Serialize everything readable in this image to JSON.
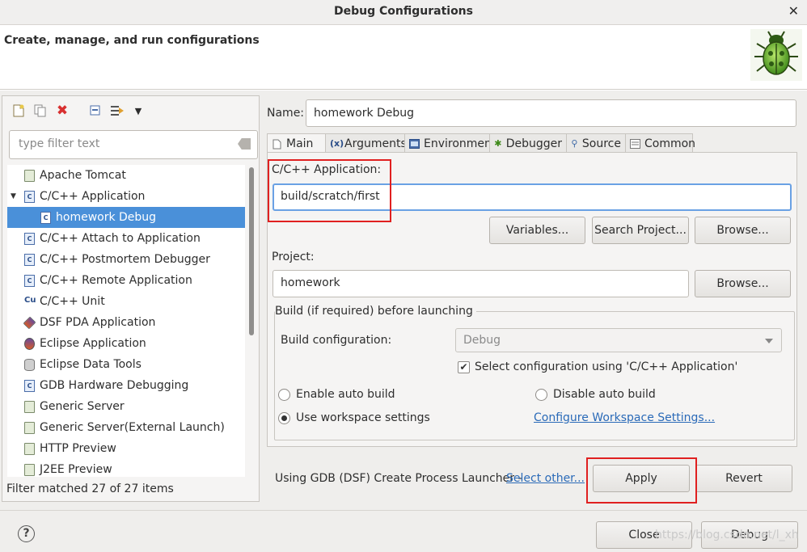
{
  "window": {
    "title": "Debug Configurations",
    "close_glyph": "✕"
  },
  "header": {
    "subtitle": "Create, manage, and run configurations"
  },
  "left": {
    "toolbar": [
      "new-configuration-icon",
      "duplicate-icon",
      "delete-icon",
      "collapse-all-icon",
      "filter-icon",
      "view-menu-icon"
    ],
    "filter_placeholder": "type filter text",
    "tree": [
      {
        "label": "Apache Tomcat"
      },
      {
        "label": "C/C++ Application"
      },
      {
        "label": "homework Debug"
      },
      {
        "label": "C/C++ Attach to Application"
      },
      {
        "label": "C/C++ Postmortem Debugger"
      },
      {
        "label": "C/C++ Remote Application"
      },
      {
        "label": "C/C++ Unit"
      },
      {
        "label": "DSF PDA Application"
      },
      {
        "label": "Eclipse Application"
      },
      {
        "label": "Eclipse Data Tools"
      },
      {
        "label": "GDB Hardware Debugging"
      },
      {
        "label": "Generic Server"
      },
      {
        "label": "Generic Server(External Launch)"
      },
      {
        "label": "HTTP Preview"
      },
      {
        "label": "J2EE Preview"
      }
    ],
    "status": "Filter matched 27 of 27 items"
  },
  "config": {
    "name_label": "Name:",
    "name_value": "homework Debug",
    "tabs": [
      "Main",
      "Arguments",
      "Environment",
      "Debugger",
      "Source",
      "Common"
    ],
    "app_label": "C/C++ Application:",
    "app_value": "build/scratch/first",
    "variables_btn": "Variables...",
    "search_project_btn": "Search Project...",
    "browse_btn": "Browse...",
    "project_label": "Project:",
    "project_value": "homework",
    "project_browse_btn": "Browse...",
    "build_group_title": "Build (if required) before launching",
    "build_config_label": "Build configuration:",
    "build_config_value": "Debug",
    "select_config_label": "Select configuration using 'C/C++ Application'",
    "enable_auto_build": "Enable auto build",
    "disable_auto_build": "Disable auto build",
    "use_workspace": "Use workspace settings",
    "configure_workspace_link": "Configure Workspace Settings..."
  },
  "footer": {
    "launcher_text": "Using GDB (DSF) Create Process Launcher -",
    "select_other": "Select other...",
    "apply": "Apply",
    "revert": "Revert",
    "close": "Close",
    "debug": "Debug",
    "help_glyph": "?",
    "watermark": "https://blog.csdn.net/l_xh"
  },
  "colors": {
    "selection": "#4a90d9",
    "highlight_box": "#e02020",
    "link": "#2a6ab8"
  }
}
